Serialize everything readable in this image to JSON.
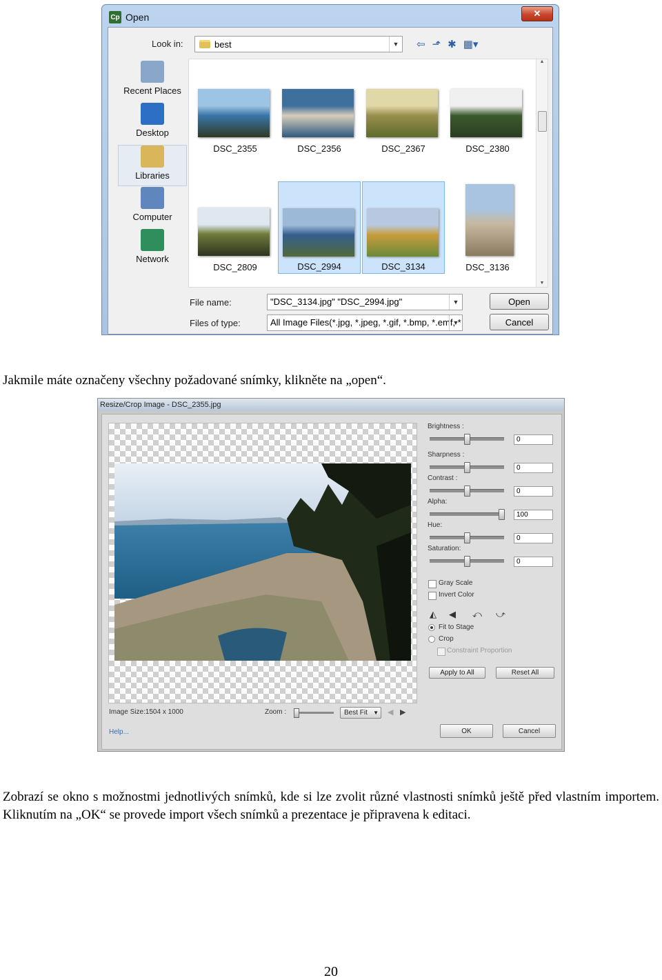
{
  "open_dialog": {
    "app_badge": "Cp",
    "title": "Open",
    "close_glyph": "✕",
    "look_in_label": "Look in:",
    "look_in_value": "best",
    "toolbar_icons": [
      "back-icon",
      "up-folder-icon",
      "new-folder-icon",
      "view-menu-icon"
    ],
    "places": [
      {
        "label": "Recent Places",
        "icon": "recent-places-icon",
        "color": "#8aa6c9"
      },
      {
        "label": "Desktop",
        "icon": "desktop-icon",
        "color": "#2d6fc4"
      },
      {
        "label": "Libraries",
        "icon": "libraries-icon",
        "color": "#d9b65a"
      },
      {
        "label": "Computer",
        "icon": "computer-icon",
        "color": "#5f86bd"
      },
      {
        "label": "Network",
        "icon": "network-icon",
        "color": "#2f8e5b"
      }
    ],
    "files": [
      {
        "name": "DSC_2355",
        "selected": false,
        "colors": [
          "#9cc4e4",
          "#3a76a8",
          "#2e3a25"
        ]
      },
      {
        "name": "DSC_2356",
        "selected": false,
        "colors": [
          "#3f6f9c",
          "#d6cdb9",
          "#2f5a80"
        ]
      },
      {
        "name": "DSC_2367",
        "selected": false,
        "colors": [
          "#e1d8a8",
          "#9a8f4c",
          "#5e6a2d"
        ]
      },
      {
        "name": "DSC_2380",
        "selected": false,
        "colors": [
          "#f0f0f0",
          "#3c5a2e",
          "#2a3d20"
        ]
      },
      {
        "name": "DSC_2809",
        "selected": false,
        "colors": [
          "#dfe8f0",
          "#6f7a3a",
          "#2d3520"
        ]
      },
      {
        "name": "DSC_2994",
        "selected": true,
        "colors": [
          "#9cbad8",
          "#355e8e",
          "#4f6a3a"
        ]
      },
      {
        "name": "DSC_3134",
        "selected": true,
        "colors": [
          "#b8c8e0",
          "#c89c3a",
          "#6a8a3a"
        ]
      },
      {
        "name": "DSC_3136",
        "selected": false,
        "colors": [
          "#a9c4e0",
          "#c7b9a0",
          "#8a7a60"
        ]
      }
    ],
    "file_name_label": "File name:",
    "file_name_value": "\"DSC_3134.jpg\" \"DSC_2994.jpg\"",
    "files_of_type_label": "Files of type:",
    "files_of_type_value": "All Image Files(*.jpg, *.jpeg, *.gif, *.bmp, *.emf, *",
    "open_button": "Open",
    "cancel_button": "Cancel"
  },
  "paragraph1": "Jakmile máte označeny všechny požadované snímky, klikněte na „open“.",
  "resize_dialog": {
    "title": "Resize/Crop Image - DSC_2355.jpg",
    "adjustments": [
      {
        "label": "Brightness :",
        "value": "0",
        "level": 0.5
      },
      {
        "label": "Sharpness :",
        "value": "0",
        "level": 0.5
      },
      {
        "label": "Contrast :",
        "value": "0",
        "level": 0.5
      },
      {
        "label": "Alpha:",
        "value": "100",
        "level": 1.0
      },
      {
        "label": "Hue:",
        "value": "0",
        "level": 0.5
      },
      {
        "label": "Saturation:",
        "value": "0",
        "level": 0.5
      }
    ],
    "gray_scale_label": "Gray Scale",
    "invert_color_label": "Invert Color",
    "transform_icons": [
      "flip-horizontal-icon",
      "flip-vertical-icon",
      "rotate-left-icon",
      "rotate-right-icon"
    ],
    "fit_to_stage_label": "Fit to Stage",
    "crop_label": "Crop",
    "constraint_label": "Constraint Proportion",
    "apply_all_button": "Apply to All",
    "reset_all_button": "Reset All",
    "image_size": "Image Size:1504 x 1000",
    "zoom_label": "Zoom :",
    "zoom_select": "Best Fit",
    "help_link": "Help...",
    "ok_button": "OK",
    "cancel_button": "Cancel"
  },
  "paragraph2": "Zobrazí se okno s možnostmi jednotlivých snímků, kde si lze zvolit různé vlastnosti snímků ještě před vlastním importem. Kliknutím na „OK“ se provede import všech snímků a prezentace je připravena k editaci.",
  "page_number": "20"
}
